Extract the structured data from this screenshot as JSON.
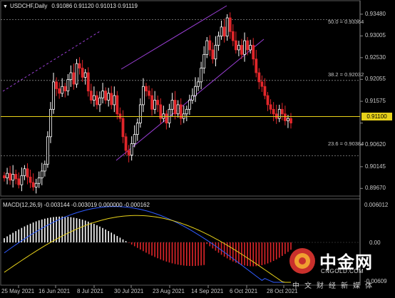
{
  "header": {
    "symbol": "USDCHF,Daily",
    "ohlc": "0.91086 0.91120 0.91013 0.91119"
  },
  "current_price": "0.91100",
  "price_axis": [
    "0.93480",
    "0.93005",
    "0.92530",
    "0.92055",
    "0.91575",
    "0.91100",
    "0.90620",
    "0.90145",
    "0.89670"
  ],
  "fib_levels": [
    {
      "label": "50.0 = 0.93364",
      "value": 0.93364
    },
    {
      "label": "38.2 = 0.92032",
      "value": 0.92032
    },
    {
      "label": "23.6 = 0.90384",
      "value": 0.90384
    }
  ],
  "macd": {
    "header": "MACD(12,26,9) -0.003144 -0.003019 0.000000 -0.000162",
    "axis": [
      "0.006012",
      "0.00",
      "-0.00609"
    ]
  },
  "time_axis": [
    "25 May 2021",
    "16 Jun 2021",
    "8 Jul 2021",
    "30 Jul 2021",
    "23 Aug 2021",
    "14 Sep 2021",
    "6 Oct 2021",
    "28 Oct 2021"
  ],
  "watermark": {
    "brand": "中金网",
    "url": "CNGOLD.COM",
    "tagline": "中文财经新媒体"
  },
  "colors": {
    "background": "#000000",
    "bull_candle": "#ffffff",
    "bear_candle": "#e0262a",
    "price_line": "#e8d21a",
    "channel": "#9b3fd6",
    "macd_hist_pos": "#ffffff",
    "macd_hist_neg": "#e0262a",
    "macd_line": "#2f5bff",
    "signal_line": "#e8d21a",
    "grid": "#5a5a5a"
  },
  "chart_data": {
    "type": "candlestick",
    "title": "USDCHF,Daily",
    "x_range": [
      "25 May 2021",
      "3 Nov 2021"
    ],
    "ylim": [
      0.8955,
      0.9365
    ],
    "series": [
      {
        "name": "MACD(12,26,9)",
        "ylim": [
          -0.00609,
          0.006012
        ]
      }
    ],
    "key_prices": {
      "high_sep": 0.9365,
      "low_jun": 0.8967,
      "low_aug": 0.9015,
      "last": 0.911
    }
  }
}
